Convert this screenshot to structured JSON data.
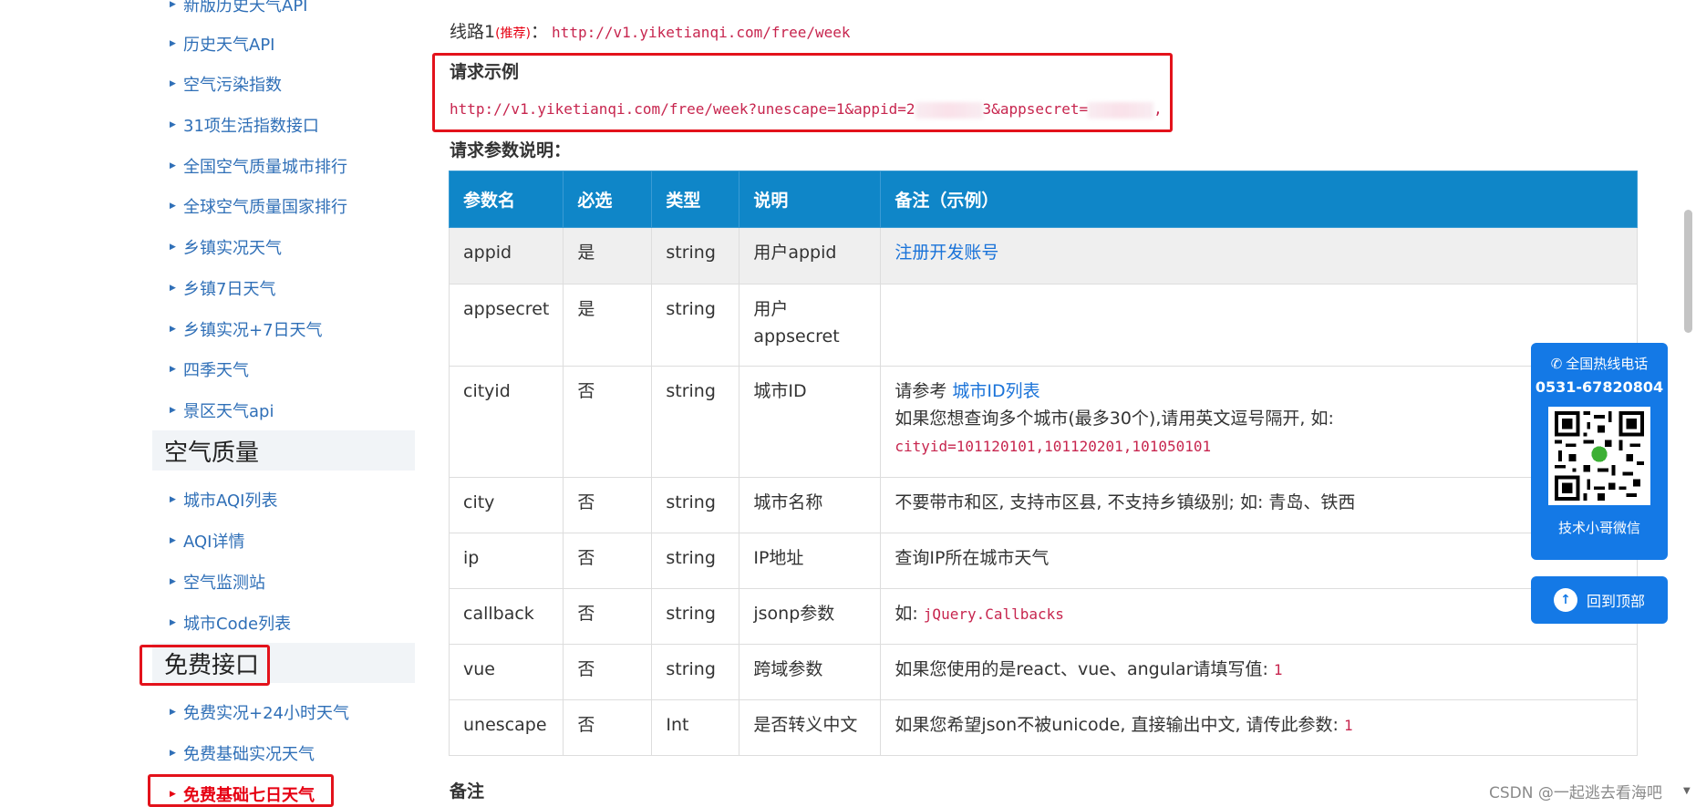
{
  "sidebar": {
    "items_top": [
      {
        "label": "新版历史天气API"
      },
      {
        "label": "历史天气API"
      },
      {
        "label": "空气污染指数"
      },
      {
        "label": "31项生活指数接口"
      },
      {
        "label": "全国空气质量城市排行"
      },
      {
        "label": "全球空气质量国家排行"
      },
      {
        "label": "乡镇实况天气"
      },
      {
        "label": "乡镇7日天气"
      },
      {
        "label": "乡镇实况+7日天气"
      },
      {
        "label": "四季天气"
      },
      {
        "label": "景区天气api"
      }
    ],
    "section_air": "空气质量",
    "items_air": [
      {
        "label": "城市AQI列表"
      },
      {
        "label": "AQI详情"
      },
      {
        "label": "空气监测站"
      },
      {
        "label": "城市Code列表"
      }
    ],
    "section_free": "免费接口",
    "items_free": [
      {
        "label": "免费实况+24小时天气"
      },
      {
        "label": "免费基础实况天气"
      },
      {
        "label": "免费基础七日天气"
      }
    ]
  },
  "main": {
    "line_label": "线路1",
    "line_tag": "(推荐)",
    "line_colon": "：",
    "line_url": "http://v1.yiketianqi.com/free/week",
    "request_example_title": "请求示例",
    "request_url_start": "http://v1.yiketianqi.com/free/week?unescape=1&appid=2",
    "request_url_mid": "3&appsecret=",
    "request_url_end": ",",
    "params_title": "请求参数说明：",
    "notes_title": "备注",
    "table": {
      "headers": [
        "参数名",
        "必选",
        "类型",
        "说明",
        "备注（示例）"
      ],
      "rows": [
        {
          "name": "appid",
          "required": "是",
          "type": "string",
          "desc": "用户appid",
          "note_link": "注册开发账号"
        },
        {
          "name": "appsecret",
          "required": "是",
          "type": "string",
          "desc": "用户appsecret"
        },
        {
          "name": "cityid",
          "required": "否",
          "type": "string",
          "desc": "城市ID",
          "note_prefix": "请参考 ",
          "note_link": "城市ID列表",
          "note_line2": "如果您想查询多个城市(最多30个),请用英文逗号隔开, 如:",
          "note_code": "cityid=101120101,101120201,101050101"
        },
        {
          "name": "city",
          "required": "否",
          "type": "string",
          "desc": "城市名称",
          "note": "不要带市和区, 支持市区县, 不支持乡镇级别; 如: 青岛、铁西"
        },
        {
          "name": "ip",
          "required": "否",
          "type": "string",
          "desc": "IP地址",
          "note": "查询IP所在城市天气"
        },
        {
          "name": "callback",
          "required": "否",
          "type": "string",
          "desc": "jsonp参数",
          "note_prefix": "如: ",
          "note_code": "jQuery.Callbacks"
        },
        {
          "name": "vue",
          "required": "否",
          "type": "string",
          "desc": "跨域参数",
          "note_prefix": "如果您使用的是react、vue、angular请填写值: ",
          "note_code": "1"
        },
        {
          "name": "unescape",
          "required": "否",
          "type": "Int",
          "desc": "是否转义中文",
          "note_prefix": "如果您希望json不被unicode, 直接输出中文, 请传此参数: ",
          "note_code": "1"
        }
      ]
    }
  },
  "widgets": {
    "hotline_label": "全国热线电话",
    "hotline_icon": "phone-icon",
    "hotline_number": "0531-67820804",
    "qr_caption": "技术小哥微信",
    "back_to_top": "回到顶部"
  },
  "watermark": "CSDN @一起逃去看海吧",
  "colors": {
    "link": "#2f6fb7",
    "active": "#e60012",
    "table_header": "#0f86c8",
    "widget_blue": "#1479e6",
    "highlight_box": "#e3121b"
  }
}
